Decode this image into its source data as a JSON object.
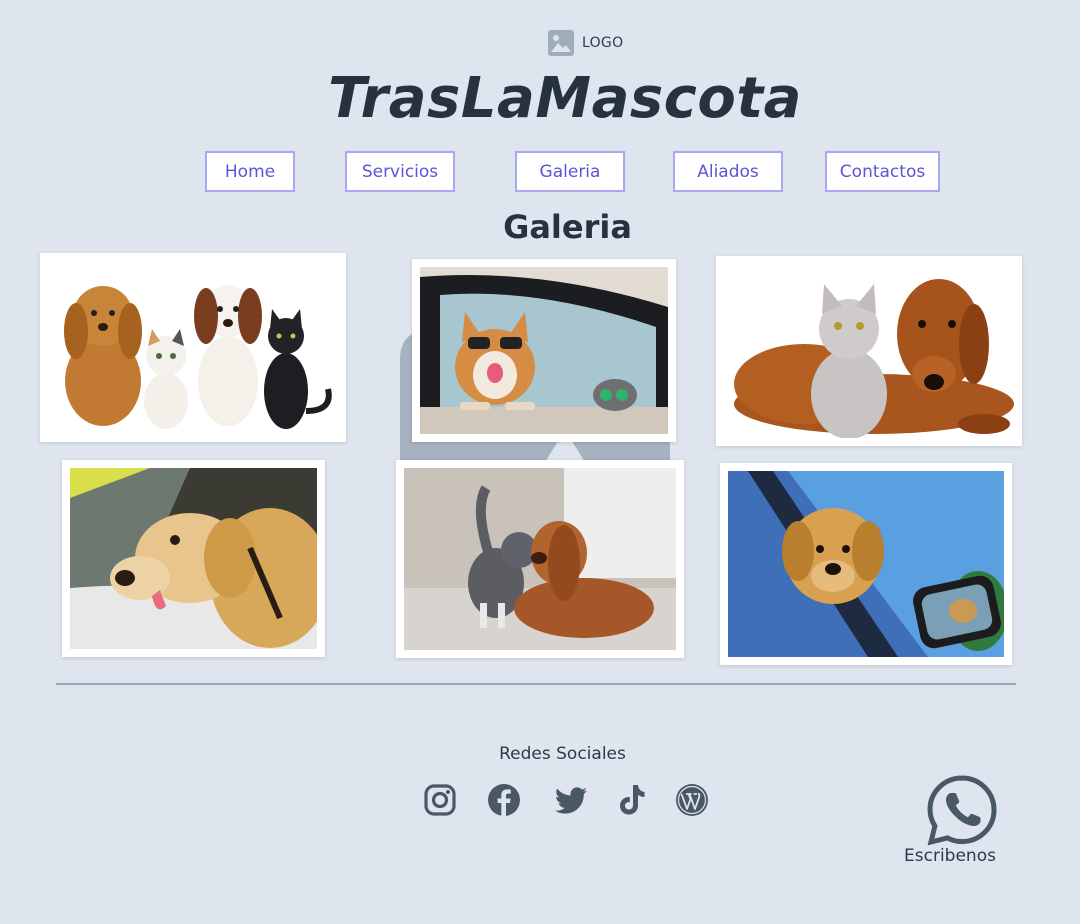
{
  "header": {
    "logo_text": "LOGO",
    "title": "TrasLaMascota"
  },
  "nav": {
    "items": [
      {
        "label": "Home"
      },
      {
        "label": "Servicios"
      },
      {
        "label": "Galeria"
      },
      {
        "label": "Aliados"
      },
      {
        "label": "Contactos"
      }
    ]
  },
  "gallery": {
    "title": "Galeria",
    "photos": [
      {
        "icon": "puppies-and-kittens-photo"
      },
      {
        "icon": "corgi-in-car-window-photo"
      },
      {
        "icon": "kitten-and-dachshund-photo"
      },
      {
        "icon": "golden-retriever-in-car-photo"
      },
      {
        "icon": "cat-and-dog-nuzzling-photo"
      },
      {
        "icon": "dog-in-car-mirror-photo"
      }
    ]
  },
  "footer": {
    "social_title": "Redes Sociales",
    "social_icons": [
      "instagram-icon",
      "facebook-icon",
      "twitter-icon",
      "tiktok-icon",
      "wordpress-icon"
    ],
    "whatsapp_label": "Escribenos"
  },
  "colors": {
    "background": "#dfe5ee",
    "nav_border": "#a8a8f0",
    "nav_text": "#5b55d6",
    "heading": "#27323f",
    "icon": "#4a5866"
  }
}
